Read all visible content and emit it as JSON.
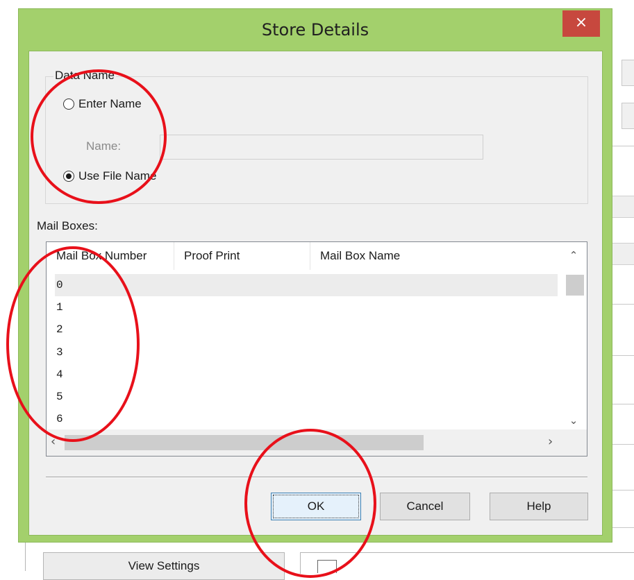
{
  "dialog": {
    "title": "Store Details",
    "close_glyph": "×"
  },
  "data_name_group": {
    "legend": "Data Name",
    "enter_name_label": "Enter Name",
    "enter_name_checked": false,
    "name_label": "Name:",
    "name_value": "",
    "use_file_name_label": "Use File Name",
    "use_file_name_checked": true
  },
  "mail_boxes": {
    "label": "Mail Boxes:",
    "columns": [
      "Mail Box Number",
      "Proof Print",
      "Mail Box Name"
    ],
    "rows": [
      {
        "number": "0",
        "proof_print": "",
        "name": "",
        "selected": true
      },
      {
        "number": "1",
        "proof_print": "",
        "name": ""
      },
      {
        "number": "2",
        "proof_print": "",
        "name": ""
      },
      {
        "number": "3",
        "proof_print": "",
        "name": ""
      },
      {
        "number": "4",
        "proof_print": "",
        "name": ""
      },
      {
        "number": "5",
        "proof_print": "",
        "name": ""
      },
      {
        "number": "6",
        "proof_print": "",
        "name": ""
      }
    ]
  },
  "buttons": {
    "ok": "OK",
    "cancel": "Cancel",
    "help": "Help"
  },
  "background_window": {
    "view_settings": "View Settings"
  },
  "icons": {
    "close": "close-icon",
    "scroll_up": "chevron-up-icon",
    "scroll_down": "chevron-down-icon",
    "scroll_left": "chevron-left-icon",
    "scroll_right": "chevron-right-icon"
  },
  "colors": {
    "dialog_frame": "#a3d06c",
    "close_button": "#c7483e",
    "annotation": "#e8101a"
  }
}
